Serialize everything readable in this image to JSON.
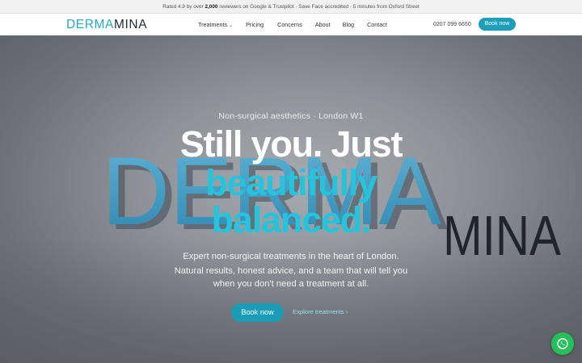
{
  "announcement": {
    "prefix": "Rated 4.9 by over",
    "count": "2,000",
    "suffix": "reviewers on Google & Trustpilot · Save Face accredited · 5 minutes from Oxford Street"
  },
  "nav": {
    "logo_part1": "DERMA",
    "logo_part2": "MINA",
    "items": [
      "Treatments",
      "Pricing",
      "Concerns",
      "About",
      "Blog",
      "Contact"
    ],
    "phone": "0207 099 6650",
    "book_label": "Book now"
  },
  "hero": {
    "eyebrow": "Non-surgical aesthetics · London W1",
    "headline_1": "Still you. Just",
    "headline_2": "beautifully",
    "headline_3": "balanced.",
    "sub_1": "Expert non-surgical treatments in the heart of London.",
    "sub_2": "Natural results, honest advice, and a team that will tell you",
    "sub_3": "when you don't need a treatment at all.",
    "cta_label": "Book now",
    "explore_label": "Explore treatments ›",
    "sign_part1": "DERMA",
    "sign_part2": "MINA"
  },
  "colors": {
    "brand_teal": "#1d9fbb",
    "headline_accent": "#25c4dc",
    "whatsapp": "#25c05a"
  },
  "icons": {
    "treatments_dropdown": "chevron-down-icon",
    "whatsapp": "whatsapp-icon"
  }
}
